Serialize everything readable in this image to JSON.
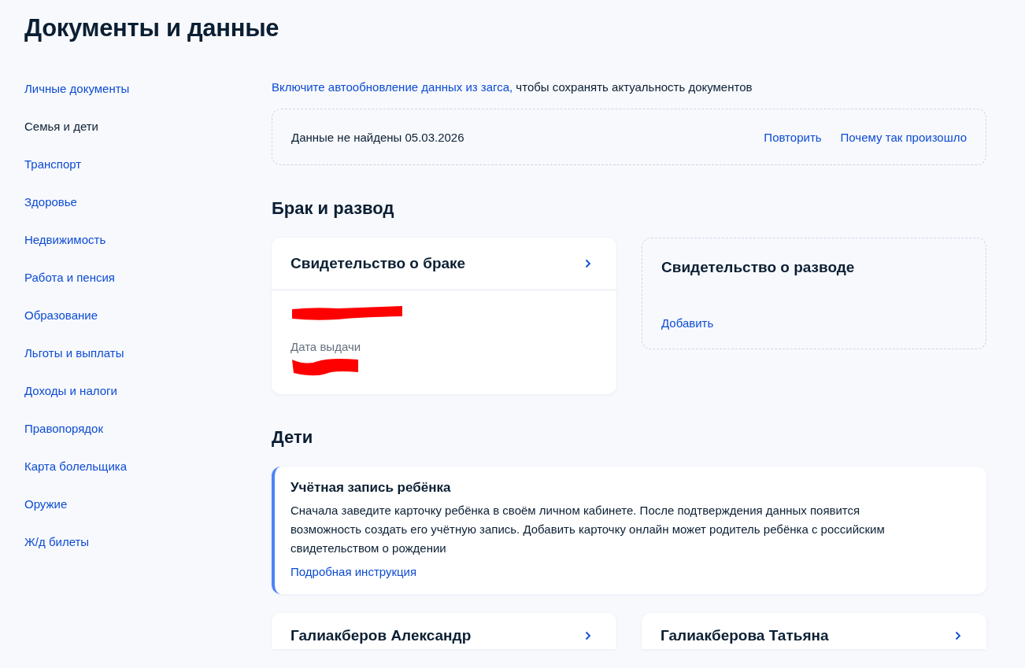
{
  "page_title": "Документы и данные",
  "sidebar": {
    "items": [
      {
        "label": "Личные документы",
        "selected": false
      },
      {
        "label": "Семья и дети",
        "selected": true
      },
      {
        "label": "Транспорт",
        "selected": false
      },
      {
        "label": "Здоровье",
        "selected": false
      },
      {
        "label": "Недвижимость",
        "selected": false
      },
      {
        "label": "Работа и пенсия",
        "selected": false
      },
      {
        "label": "Образование",
        "selected": false
      },
      {
        "label": "Льготы и выплаты",
        "selected": false
      },
      {
        "label": "Доходы и налоги",
        "selected": false
      },
      {
        "label": "Правопорядок",
        "selected": false
      },
      {
        "label": "Карта болельщика",
        "selected": false
      },
      {
        "label": "Оружие",
        "selected": false
      },
      {
        "label": "Ж/д билеты",
        "selected": false
      }
    ]
  },
  "autoupdate_notice": {
    "link": "Включите автообновление данных из загса,",
    "text": "чтобы сохранять актуальность документов"
  },
  "status_panel": {
    "message": "Данные не найдены 05.03.2026",
    "actions": [
      "Повторить",
      "Почему так произошло"
    ]
  },
  "sections": [
    {
      "title": "Брак и развод",
      "cards": [
        {
          "kind": "document",
          "title": "Свидетельство о браке",
          "fields": [
            {
              "redacted": true
            },
            {
              "label": "Дата выдачи",
              "redacted": true
            }
          ]
        },
        {
          "kind": "empty",
          "title": "Свидетельство о разводе",
          "action": "Добавить"
        }
      ]
    },
    {
      "title": "Дети",
      "notice": {
        "title": "Учётная запись ребёнка",
        "text": "Сначала заведите карточку ребёнка в своём личном кабинете. После подтверждения данных появится возможность создать его учётную запись. Добавить карточку онлайн может родитель ребёнка с российским свидетельством о рождении",
        "link": "Подробная инструкция"
      },
      "cards": [
        {
          "kind": "person",
          "title": "Галиакберов Александр"
        },
        {
          "kind": "person",
          "title": "Галиакберова Татьяна"
        }
      ]
    }
  ]
}
